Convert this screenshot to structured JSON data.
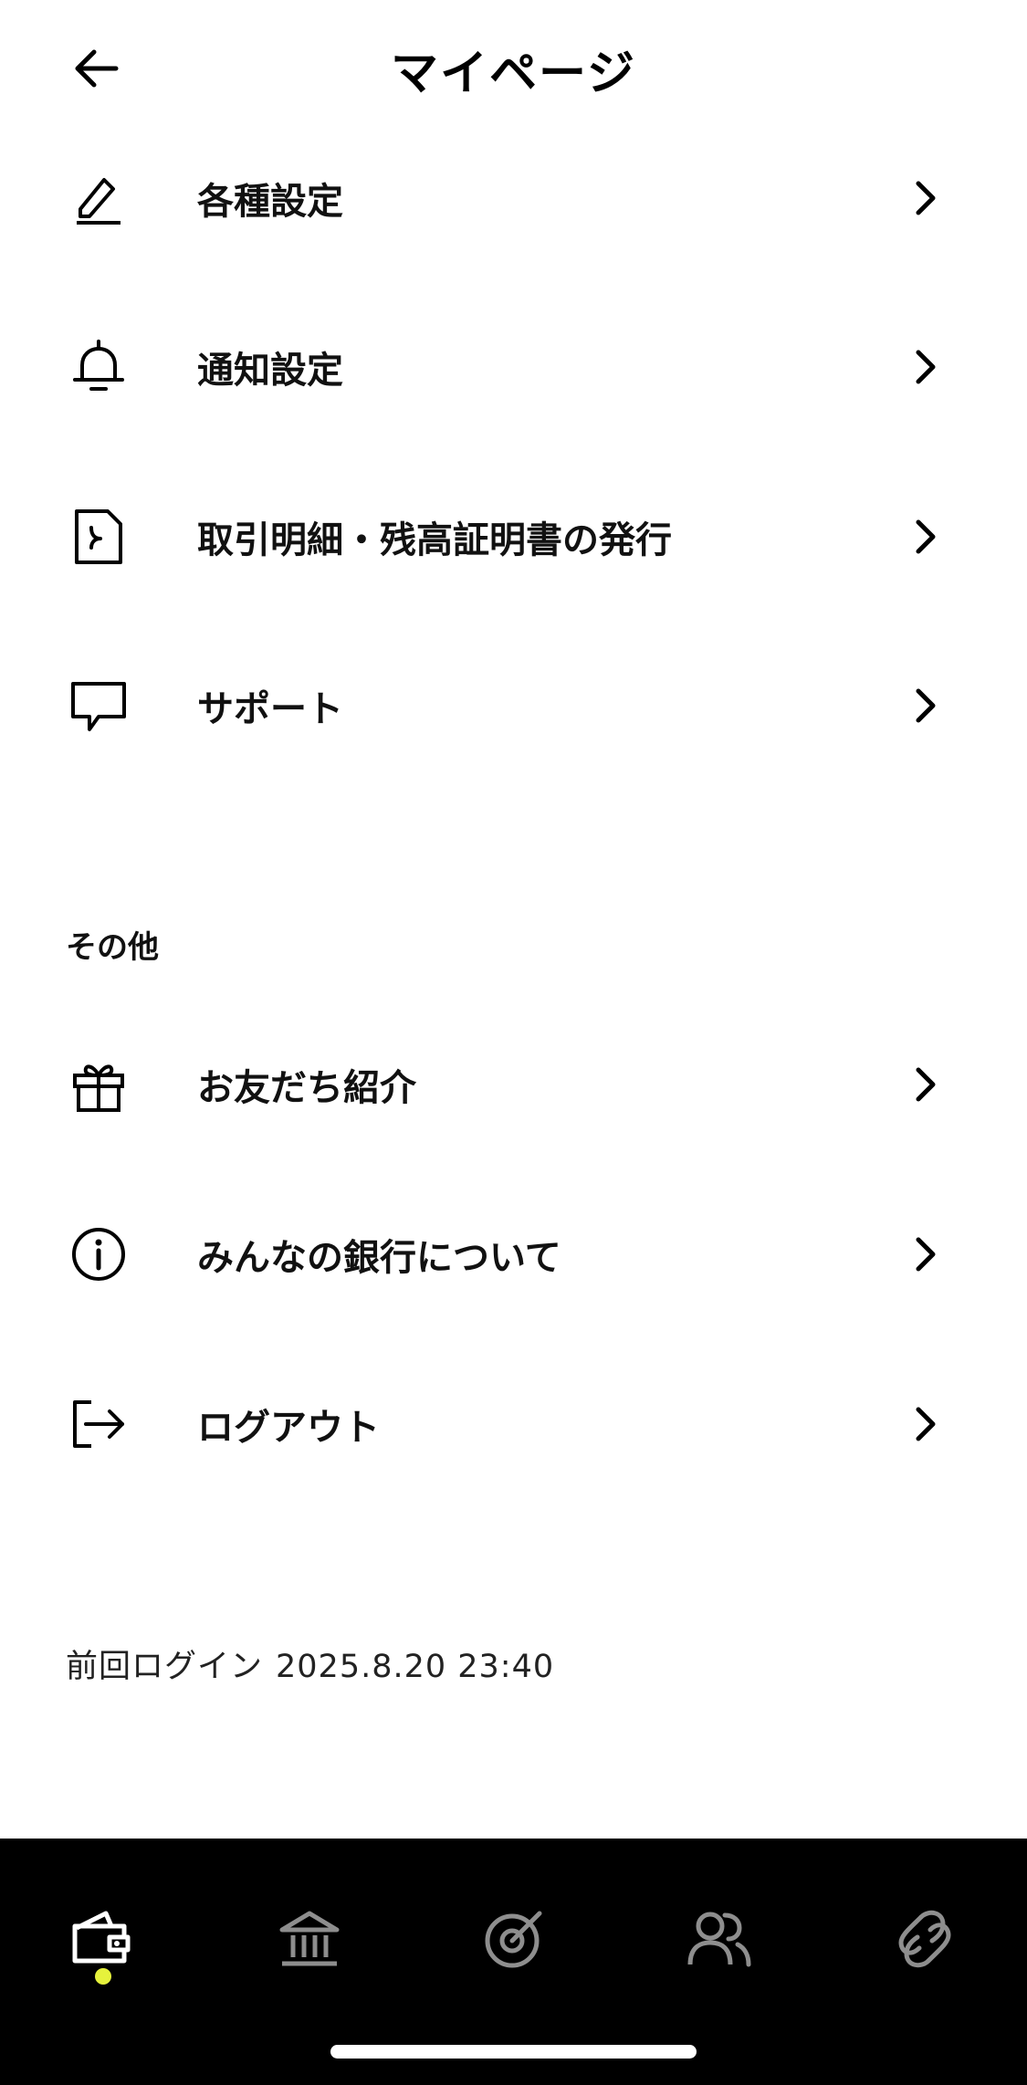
{
  "header": {
    "title": "マイページ"
  },
  "menu_main": [
    {
      "label": "各種設定",
      "icon": "pencil-icon"
    },
    {
      "label": "通知設定",
      "icon": "bell-icon"
    },
    {
      "label": "取引明細・残高証明書の発行",
      "icon": "document-icon"
    },
    {
      "label": "サポート",
      "icon": "chat-icon"
    }
  ],
  "section_other": {
    "title": "その他",
    "items": [
      {
        "label": "お友だち紹介",
        "icon": "gift-icon"
      },
      {
        "label": "みんなの銀行について",
        "icon": "info-icon"
      },
      {
        "label": "ログアウト",
        "icon": "logout-icon"
      }
    ]
  },
  "last_login": {
    "label": "前回ログイン",
    "value": "2025.8.20 23:40"
  },
  "tabbar": {
    "tabs": [
      {
        "icon": "wallet-icon",
        "active": true
      },
      {
        "icon": "bank-icon",
        "active": false
      },
      {
        "icon": "target-icon",
        "active": false
      },
      {
        "icon": "people-icon",
        "active": false
      },
      {
        "icon": "link-icon",
        "active": false
      }
    ],
    "active_color": "#ffffff",
    "inactive_color": "#8e8e8e",
    "indicator_color": "#e6f23c"
  }
}
